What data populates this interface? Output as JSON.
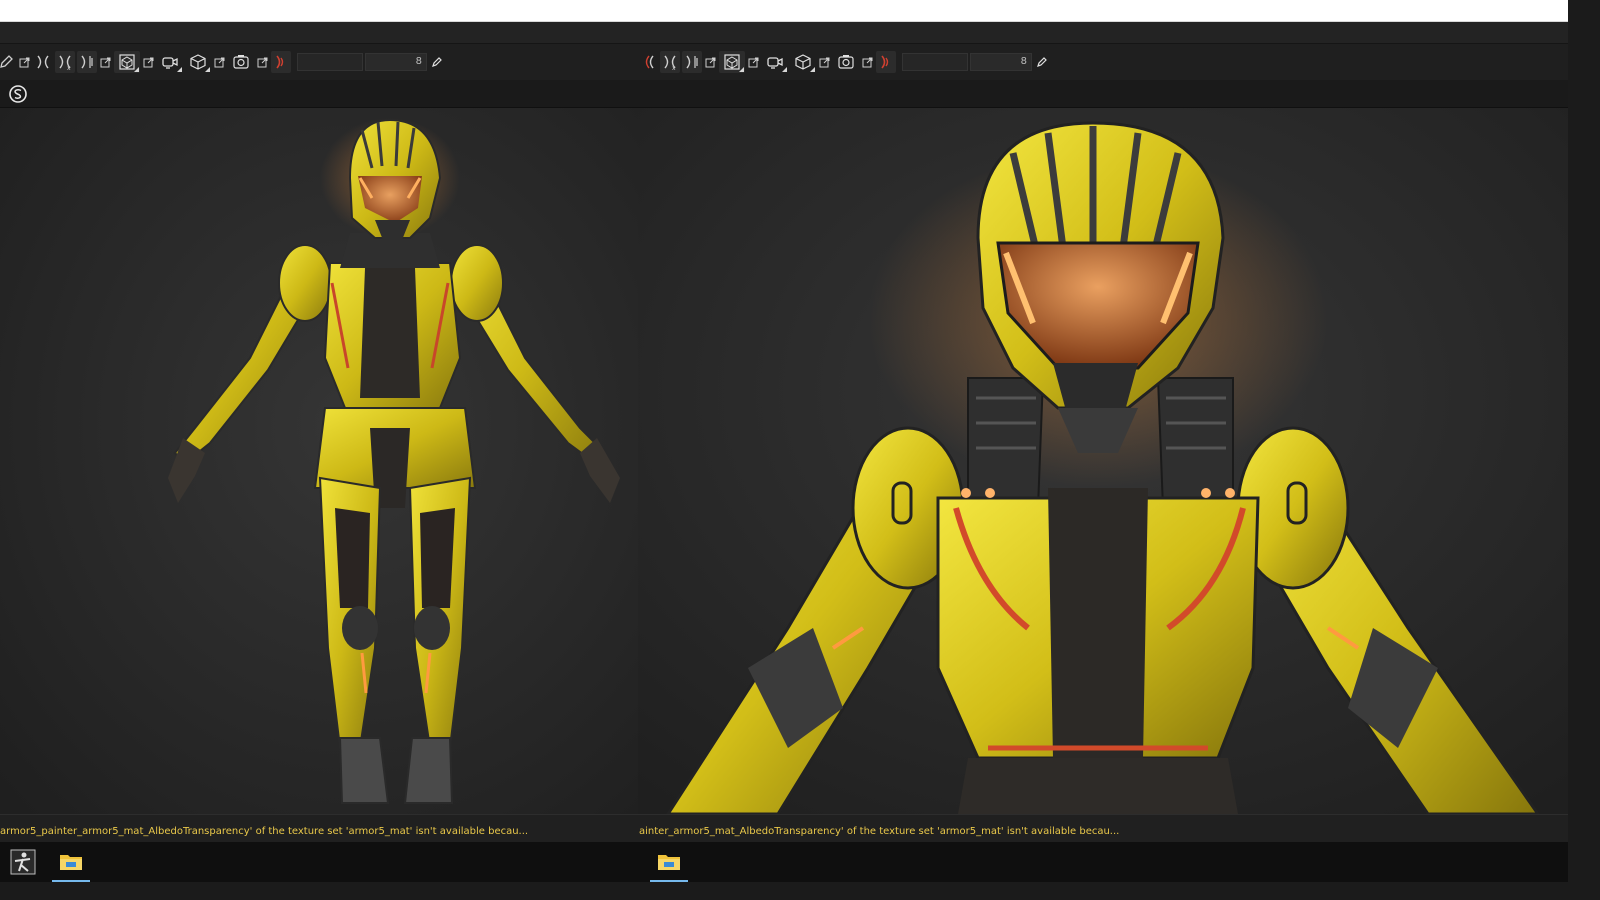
{
  "left_panel": {
    "field_value": "8",
    "status_message": "armor5_painter_armor5_mat_AlbedoTransparency' of the texture set 'armor5_mat' isn't available becau..."
  },
  "right_panel": {
    "field_value": "8",
    "status_message": "ainter_armor5_mat_AlbedoTransparency' of the texture set 'armor5_mat' isn't available becau..."
  },
  "toolbar_icons": [
    "edit-icon",
    "external-link-icon",
    "symmetry-half-icon",
    "symmetry-x-icon",
    "mirror-icon",
    "cube-icon",
    "camera-icon",
    "box-icon",
    "screenshot-icon",
    "sound-icon"
  ],
  "taskbar": {
    "apps": [
      "zbrush-icon",
      "file-explorer-icon"
    ]
  },
  "colors": {
    "status_text": "#e9c84a",
    "armor_yellow": "#d9c51a",
    "visor_orange": "#c4662a",
    "viewport_bg": "#2a2a2a",
    "taskbar_bg": "#0f0f0f"
  }
}
